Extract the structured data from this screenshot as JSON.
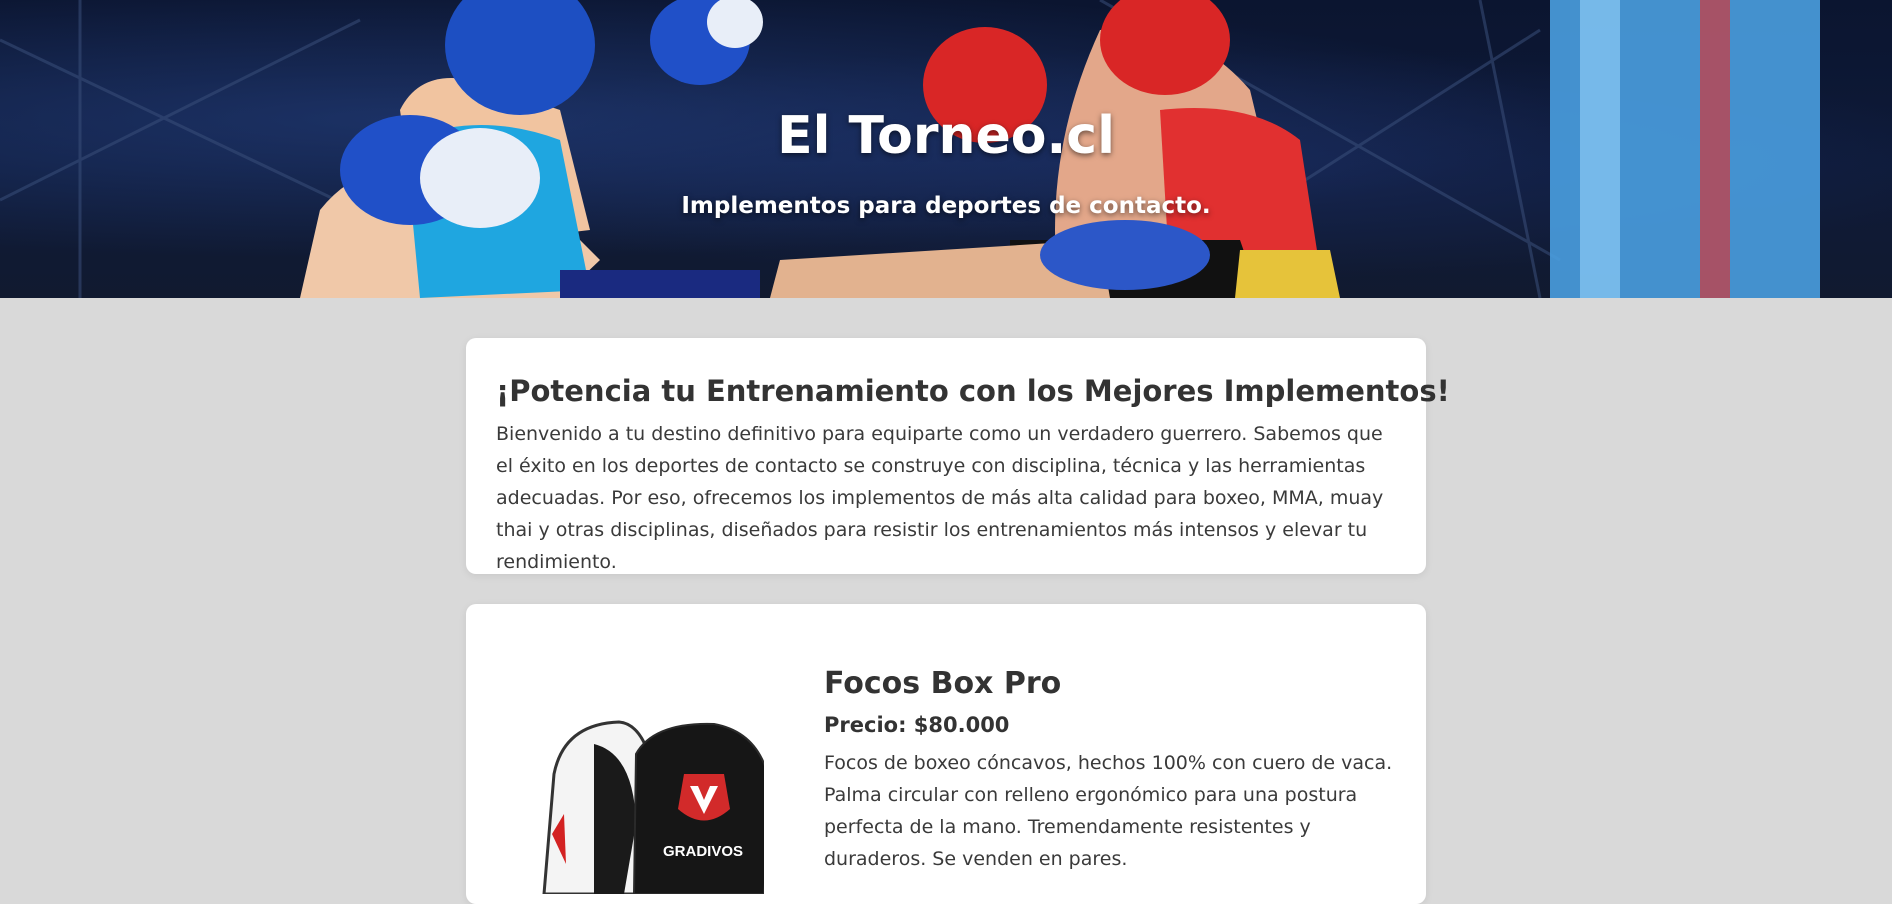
{
  "hero": {
    "title": "El Torneo.cl",
    "subtitle": "Implementos para deportes de contacto."
  },
  "intro": {
    "title": "¡Potencia tu Entrenamiento con los Mejores Implementos!",
    "text": "Bienvenido a tu destino definitivo para equiparte como un verdadero guerrero. Sabemos que el éxito en los deportes de contacto se construye con disciplina, técnica y las herramientas adecuadas. Por eso, ofrecemos los implementos de más alta calidad para boxeo, MMA, muay thai y otras disciplinas, diseñados para resistir los entrenamientos más intensos y elevar tu rendimiento."
  },
  "products": [
    {
      "name": "Focos Box Pro",
      "price": "Precio: $80.000",
      "description": "Focos de boxeo cóncavos, hechos 100% con cuero de vaca. Palma circular con relleno ergonómico para una postura perfecta de la mano. Tremendamente resistentes y duraderos. Se venden en pares.",
      "image_brand": "GRADIVOS"
    }
  ],
  "colors": {
    "page_background": "#d9d9d9",
    "card_background": "#ffffff",
    "text": "#333333",
    "hero_text": "#ffffff"
  }
}
